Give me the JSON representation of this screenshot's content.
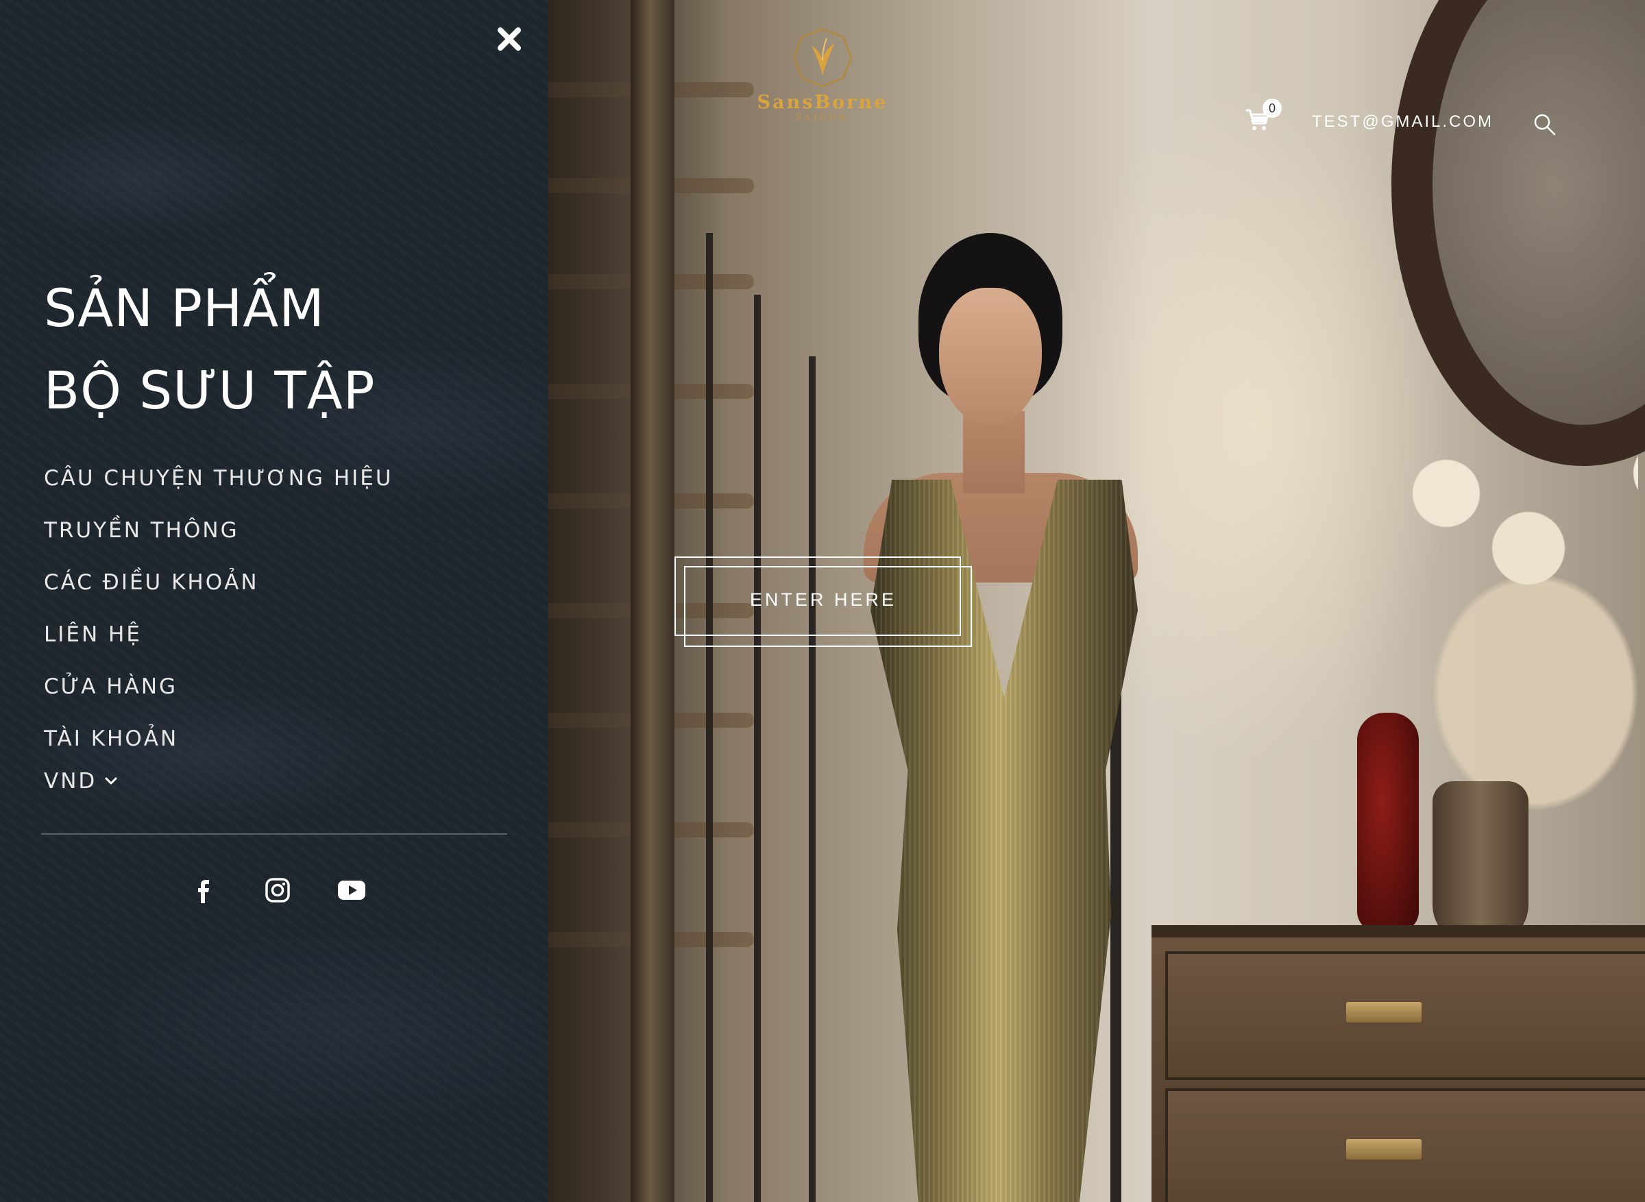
{
  "drawer": {
    "main_nav": [
      "SẢN PHẨM",
      "BỘ SƯU TẬP"
    ],
    "sub_nav": [
      "CÂU CHUYỆN THƯƠNG HIỆU",
      "TRUYỀN THÔNG",
      "CÁC ĐIỀU KHOẢN",
      "LIÊN HỆ",
      "CỬA HÀNG",
      "TÀI KHOẢN"
    ],
    "currency": "VND",
    "social_icons": [
      "facebook-icon",
      "instagram-icon",
      "youtube-icon"
    ]
  },
  "header": {
    "logo_name": "SansBorne",
    "logo_sub": "SAIGON",
    "cart_count": "0",
    "account_email": "TEST@GMAIL.COM"
  },
  "hero": {
    "cta_label": "ENTER HERE"
  },
  "colors": {
    "drawer_bg": "#1e262e",
    "logo_gold": "#d9a440",
    "text_white": "#ffffff"
  }
}
